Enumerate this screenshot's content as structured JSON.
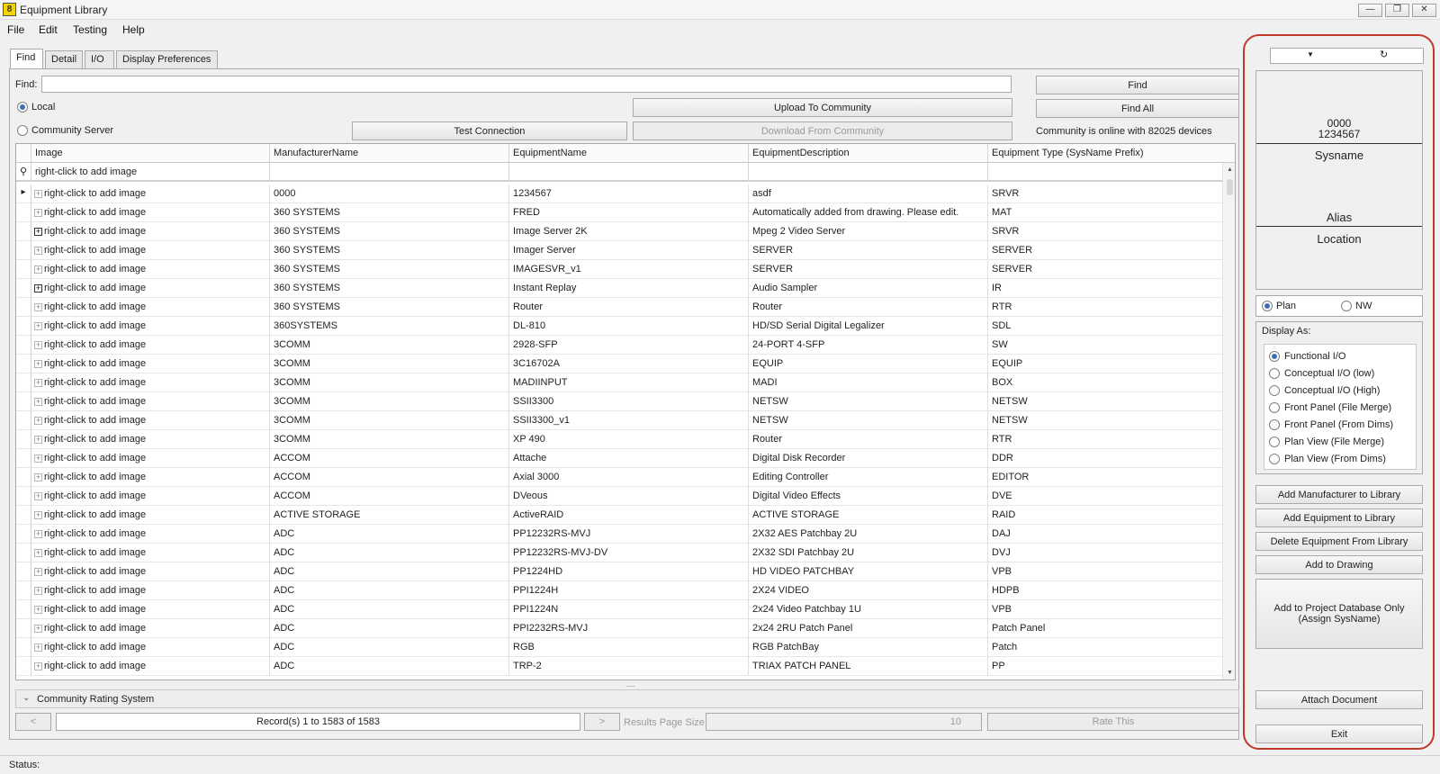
{
  "window": {
    "title": "Equipment Library",
    "icon_text": "8",
    "controls": [
      "minimize-icon",
      "restore-icon",
      "close-icon"
    ]
  },
  "menu": [
    "File",
    "Edit",
    "Testing",
    "Help"
  ],
  "tabs": [
    "Find",
    "Detail",
    "I/O",
    "Display Preferences"
  ],
  "find": {
    "label": "Find:",
    "value": "",
    "local_label": "Local",
    "community_label": "Community Server",
    "selected_source": "Local",
    "test_connection": "Test Connection",
    "upload": "Upload To Community",
    "download": "Download From Community",
    "find_btn": "Find",
    "find_all_btn": "Find All",
    "community_status": "Community is online with 82025 devices"
  },
  "grid": {
    "columns": [
      "Image",
      "ManufacturerName",
      "EquipmentName",
      "EquipmentDescription",
      "Equipment Type (SysName Prefix)"
    ],
    "filter_text": "right-click to add image",
    "rows": [
      {
        "image": "right-click to add image",
        "mfr": "0000",
        "name": "1234567",
        "desc": "asdf",
        "type": "SRVR",
        "current": true,
        "expand": false
      },
      {
        "image": "right-click to add image",
        "mfr": "360 SYSTEMS",
        "name": "FRED",
        "desc": "Automatically added from drawing. Please edit.",
        "type": "MAT",
        "current": false,
        "expand": false
      },
      {
        "image": "right-click to add image",
        "mfr": "360 SYSTEMS",
        "name": "Image Server 2K",
        "desc": "Mpeg 2 Video Server",
        "type": "SRVR",
        "current": false,
        "expand": true
      },
      {
        "image": "right-click to add image",
        "mfr": "360 SYSTEMS",
        "name": "Imager Server",
        "desc": "SERVER",
        "type": "SERVER",
        "current": false,
        "expand": false
      },
      {
        "image": "right-click to add image",
        "mfr": "360 SYSTEMS",
        "name": "IMAGESVR_v1",
        "desc": "SERVER",
        "type": "SERVER",
        "current": false,
        "expand": false
      },
      {
        "image": "right-click to add image",
        "mfr": "360 SYSTEMS",
        "name": "Instant Replay",
        "desc": "Audio Sampler",
        "type": "IR",
        "current": false,
        "expand": true
      },
      {
        "image": "right-click to add image",
        "mfr": "360 SYSTEMS",
        "name": "Router",
        "desc": "Router",
        "type": "RTR",
        "current": false,
        "expand": false
      },
      {
        "image": "right-click to add image",
        "mfr": "360SYSTEMS",
        "name": "DL-810",
        "desc": "HD/SD Serial Digital Legalizer",
        "type": "SDL",
        "current": false,
        "expand": false
      },
      {
        "image": "right-click to add image",
        "mfr": "3COMM",
        "name": "2928-SFP",
        "desc": "24-PORT 4-SFP",
        "type": "SW",
        "current": false,
        "expand": false
      },
      {
        "image": "right-click to add image",
        "mfr": "3COMM",
        "name": "3C16702A",
        "desc": "EQUIP",
        "type": "EQUIP",
        "current": false,
        "expand": false
      },
      {
        "image": "right-click to add image",
        "mfr": "3COMM",
        "name": "MADIINPUT",
        "desc": "MADI",
        "type": "BOX",
        "current": false,
        "expand": false
      },
      {
        "image": "right-click to add image",
        "mfr": "3COMM",
        "name": "SSII3300",
        "desc": "NETSW",
        "type": "NETSW",
        "current": false,
        "expand": false
      },
      {
        "image": "right-click to add image",
        "mfr": "3COMM",
        "name": "SSII3300_v1",
        "desc": "NETSW",
        "type": "NETSW",
        "current": false,
        "expand": false
      },
      {
        "image": "right-click to add image",
        "mfr": "3COMM",
        "name": "XP 490",
        "desc": "Router",
        "type": "RTR",
        "current": false,
        "expand": false
      },
      {
        "image": "right-click to add image",
        "mfr": "ACCOM",
        "name": "Attache",
        "desc": "Digital Disk Recorder",
        "type": "DDR",
        "current": false,
        "expand": false
      },
      {
        "image": "right-click to add image",
        "mfr": "ACCOM",
        "name": "Axial 3000",
        "desc": "Editing Controller",
        "type": "EDITOR",
        "current": false,
        "expand": false
      },
      {
        "image": "right-click to add image",
        "mfr": "ACCOM",
        "name": "DVeous",
        "desc": "Digital Video Effects",
        "type": "DVE",
        "current": false,
        "expand": false
      },
      {
        "image": "right-click to add image",
        "mfr": "ACTIVE STORAGE",
        "name": "ActiveRAID",
        "desc": "ACTIVE STORAGE",
        "type": "RAID",
        "current": false,
        "expand": false
      },
      {
        "image": "right-click to add image",
        "mfr": "ADC",
        "name": "PP12232RS-MVJ",
        "desc": "2X32 AES Patchbay 2U",
        "type": "DAJ",
        "current": false,
        "expand": false
      },
      {
        "image": "right-click to add image",
        "mfr": "ADC",
        "name": "PP12232RS-MVJ-DV",
        "desc": "2X32 SDI Patchbay 2U",
        "type": "DVJ",
        "current": false,
        "expand": false
      },
      {
        "image": "right-click to add image",
        "mfr": "ADC",
        "name": "PP1224HD",
        "desc": "HD VIDEO PATCHBAY",
        "type": "VPB",
        "current": false,
        "expand": false
      },
      {
        "image": "right-click to add image",
        "mfr": "ADC",
        "name": "PPI1224H",
        "desc": "2X24 VIDEO",
        "type": "HDPB",
        "current": false,
        "expand": false
      },
      {
        "image": "right-click to add image",
        "mfr": "ADC",
        "name": "PPI1224N",
        "desc": "2x24 Video Patchbay 1U",
        "type": "VPB",
        "current": false,
        "expand": false
      },
      {
        "image": "right-click to add image",
        "mfr": "ADC",
        "name": "PPI2232RS-MVJ",
        "desc": "2x24 2RU Patch Panel",
        "type": "Patch Panel",
        "current": false,
        "expand": false
      },
      {
        "image": "right-click to add image",
        "mfr": "ADC",
        "name": "RGB",
        "desc": "RGB PatchBay",
        "type": "Patch",
        "current": false,
        "expand": false
      },
      {
        "image": "right-click to add image",
        "mfr": "ADC",
        "name": "TRP-2",
        "desc": "TRIAX PATCH PANEL",
        "type": "PP",
        "current": false,
        "expand": false
      }
    ]
  },
  "rating": {
    "label": "Community Rating System"
  },
  "pager": {
    "prev": "<",
    "next": ">",
    "records": "Record(s) 1 to 1583 of 1583",
    "page_size_label": "Results Page Size",
    "page_size": "10",
    "rate": "Rate This"
  },
  "preview": {
    "line1": "0000",
    "line2": "1234567",
    "sysname": "Sysname",
    "alias": "Alias",
    "location": "Location"
  },
  "view_mode": {
    "options": [
      "Plan",
      "NW"
    ],
    "selected": "Plan"
  },
  "display_as": {
    "label": "Display As:",
    "options": [
      "Functional I/O",
      "Conceptual I/O (low)",
      "Conceptual I/O (High)",
      "Front Panel (File Merge)",
      "Front Panel (From Dims)",
      "Plan View (File Merge)",
      "Plan View (From Dims)"
    ],
    "selected": "Functional I/O"
  },
  "actions": {
    "add_manufacturer": "Add Manufacturer to Library",
    "add_equipment": "Add Equipment to Library",
    "delete_equipment": "Delete Equipment From Library",
    "add_to_drawing": "Add to Drawing",
    "add_to_project_1": "Add to Project Database Only",
    "add_to_project_2": "(Assign SysName)",
    "attach_document": "Attach Document",
    "exit": "Exit"
  },
  "status": {
    "label": "Status:"
  },
  "colors": {
    "highlight": "#c0392b",
    "radio_accent": "#3d6fb6"
  }
}
